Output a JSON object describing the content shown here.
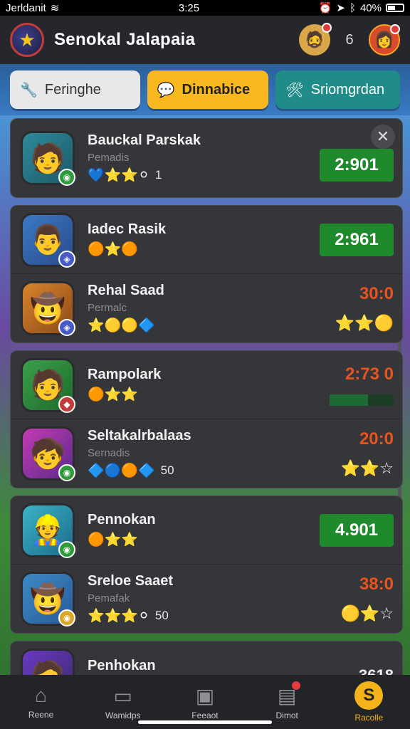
{
  "status": {
    "carrier": "Jerldanit",
    "time": "3:25",
    "battery": "40%"
  },
  "header": {
    "title": "Senokal Jalapaia",
    "count": "6"
  },
  "tabs": [
    {
      "label": "Feringhe"
    },
    {
      "label": "Dinnabice"
    },
    {
      "label": "Sriomgrdan"
    }
  ],
  "players": [
    {
      "name": "Bauckal Parskak",
      "sub": "Pemadis",
      "icons": "💙⭐⭐⚪",
      "num": "1",
      "score": "2:901",
      "style": "green"
    },
    {
      "name": "Iadec Rasik",
      "sub": "",
      "icons": "🟠⭐🟠",
      "num": "",
      "score": "2:961",
      "style": "green"
    },
    {
      "name": "Rehal Saad",
      "sub": "Permalc",
      "icons": "⭐🟡🟡🔷",
      "num": "",
      "score": "30:0",
      "style": "orange",
      "stars": "⭐⭐🟡"
    },
    {
      "name": "Rampolark",
      "sub": "",
      "icons": "🟠⭐⭐",
      "num": "",
      "score": "2:73 0",
      "style": "orange-progress",
      "progress": 0.6
    },
    {
      "name": "Seltakalrbalaas",
      "sub": "Sernadis",
      "icons": "🔷🔵🟠🔷",
      "num": "50",
      "score": "20:0",
      "style": "orange",
      "stars": "⭐⭐☆"
    },
    {
      "name": "Pennokan",
      "sub": "",
      "icons": "🟠⭐⭐",
      "num": "",
      "score": "4.901",
      "style": "green"
    },
    {
      "name": "Sreloe Saaet",
      "sub": "Pemafak",
      "icons": "⭐⭐⭐⚪",
      "num": "50",
      "score": "38:0",
      "style": "orange",
      "stars": "🟡⭐☆"
    },
    {
      "name": "Penhokan",
      "sub": "",
      "icons": "🟠🟠",
      "num": "",
      "score": "3618",
      "style": "white"
    }
  ],
  "nav": [
    {
      "label": "Reene"
    },
    {
      "label": "Wamidps"
    },
    {
      "label": "Feeaot"
    },
    {
      "label": "Dimot"
    },
    {
      "label": "Racolle"
    }
  ],
  "colors": {
    "accent": "#f4b31a",
    "green": "#1f8a2c",
    "orange": "#e8531f"
  }
}
